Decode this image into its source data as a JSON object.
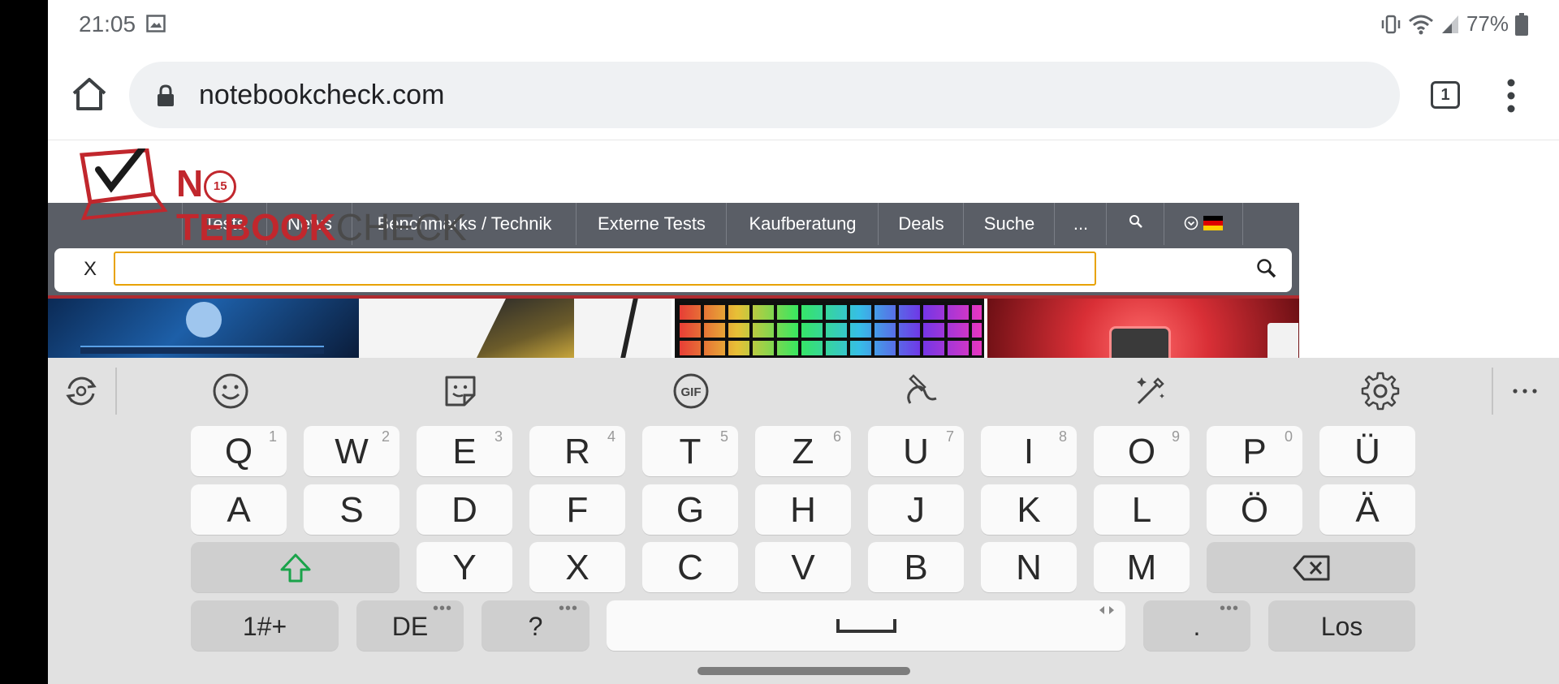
{
  "status_bar": {
    "time": "21:05",
    "battery": "77%"
  },
  "browser": {
    "url": "notebookcheck.com",
    "tab_count": "1"
  },
  "site": {
    "logo": {
      "part1": "N",
      "part2": "TEBOOK",
      "part3": "CHECK",
      "badge": "15"
    },
    "nav": [
      "Tests",
      "News",
      "Benchmarks / Technik",
      "Externe Tests",
      "Kaufberatung",
      "Deals",
      "Suche",
      "..."
    ],
    "search": {
      "close_label": "X",
      "value": ""
    }
  },
  "keyboard": {
    "row1": [
      {
        "key": "Q",
        "hint": "1"
      },
      {
        "key": "W",
        "hint": "2"
      },
      {
        "key": "E",
        "hint": "3"
      },
      {
        "key": "R",
        "hint": "4"
      },
      {
        "key": "T",
        "hint": "5"
      },
      {
        "key": "Z",
        "hint": "6"
      },
      {
        "key": "U",
        "hint": "7"
      },
      {
        "key": "I",
        "hint": "8"
      },
      {
        "key": "O",
        "hint": "9"
      },
      {
        "key": "P",
        "hint": "0"
      },
      {
        "key": "Ü",
        "hint": ""
      }
    ],
    "row2": [
      "A",
      "S",
      "D",
      "F",
      "G",
      "H",
      "J",
      "K",
      "L",
      "Ö",
      "Ä"
    ],
    "row3": [
      "Y",
      "X",
      "C",
      "V",
      "B",
      "N",
      "M"
    ],
    "symbols_label": "1#+",
    "language_label": "DE",
    "question_label": "?",
    "period_label": ".",
    "enter_label": "Los",
    "accent_color": "#1aa34a"
  }
}
